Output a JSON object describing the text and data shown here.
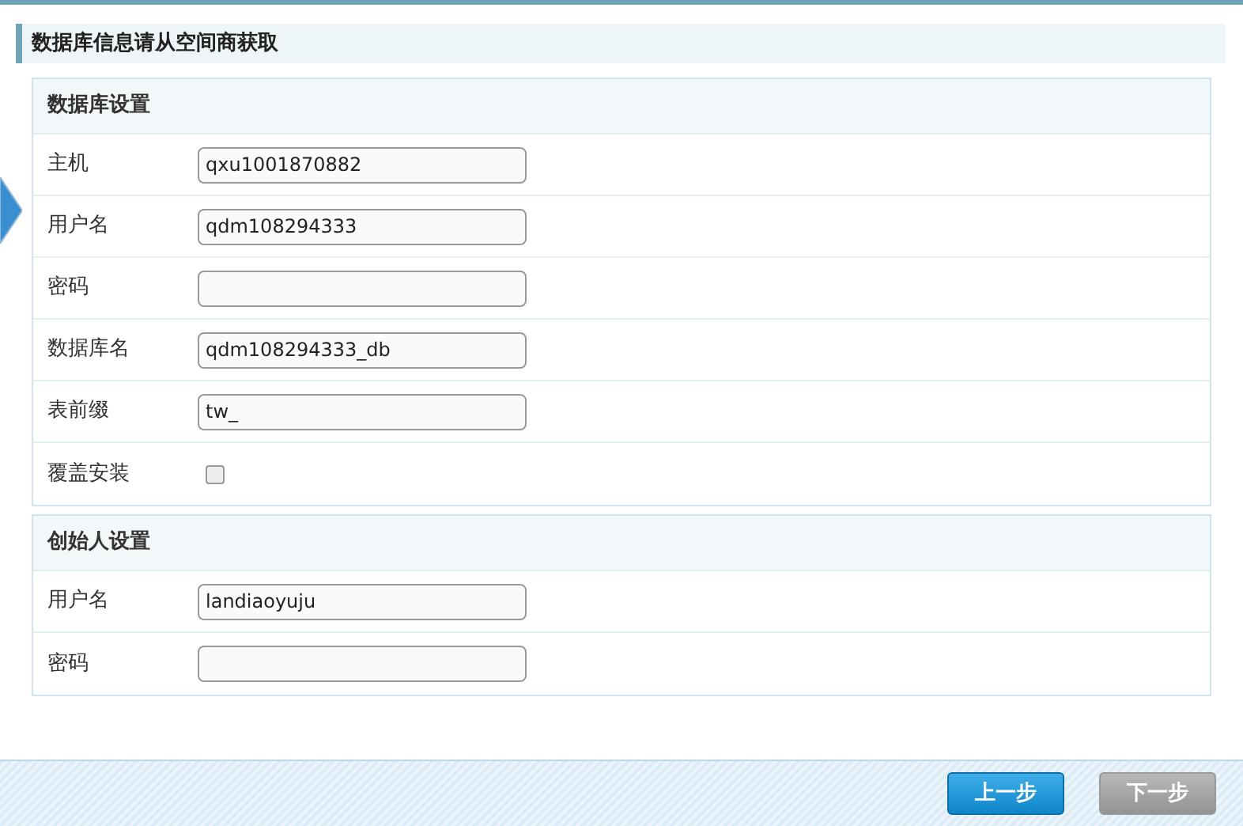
{
  "heading": "数据库信息请从空间商获取",
  "sections": [
    {
      "title": "数据库设置",
      "fields": [
        {
          "kind": "text",
          "label": "主机",
          "value": "qxu1001870882"
        },
        {
          "kind": "text",
          "label": "用户名",
          "value": "qdm108294333"
        },
        {
          "kind": "text",
          "label": "密码"
        },
        {
          "kind": "text",
          "label": "数据库名",
          "value": "qdm108294333_db"
        },
        {
          "kind": "text",
          "label": "表前缀",
          "value": "tw_"
        },
        {
          "kind": "checkbox",
          "label": "覆盖安装",
          "checked": false
        }
      ]
    },
    {
      "title": "创始人设置",
      "fields": [
        {
          "kind": "text",
          "label": "用户名",
          "value": "landiaoyuju"
        },
        {
          "kind": "text",
          "label": "密码"
        }
      ]
    }
  ],
  "buttons": [
    {
      "label": "上一步",
      "disabled": false
    },
    {
      "label": "下一步",
      "disabled": true
    }
  ]
}
